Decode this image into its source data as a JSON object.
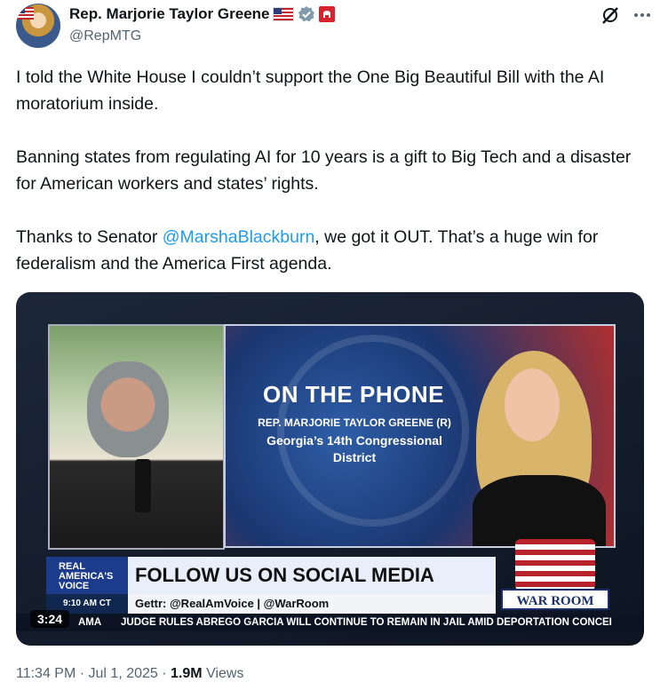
{
  "author": {
    "name": "Rep. Marjorie Taylor Greene",
    "handle": "@RepMTG"
  },
  "icons": {
    "flag": "us-flag-icon",
    "verified": "verified-badge-icon",
    "affiliate": "gop-badge-icon",
    "grok": "grok-icon",
    "more": "more-icon"
  },
  "tweet": {
    "p1": "I told the White House I couldn’t support the One Big Beautiful Bill with the AI moratorium inside.",
    "p2": "Banning states from regulating AI for 10 years is a gift to Big Tech and a disaster for American workers and states’ rights.",
    "p3_before": "Thanks to Senator ",
    "p3_mention": "@MarshaBlackburn",
    "p3_after": ", we got it OUT. That’s a huge win for federalism and the America First agenda."
  },
  "video": {
    "phone_title": "ON THE PHONE",
    "phone_name": "REP. MARJORIE TAYLOR GREENE (R)",
    "phone_district_1": "Georgia’s 14th Congressional",
    "phone_district_2": "District",
    "network_1": "REAL",
    "network_2": "AMERICA'S",
    "network_3": "VOICE",
    "time": "9:10 AM CT",
    "banner": "FOLLOW US ON SOCIAL MEDIA",
    "gettr": "Gettr: @RealAmVoice | @WarRoom",
    "show_logo": "WAR ROOM",
    "crawl_prefix": "AMA",
    "crawl_text": "JUDGE RULES ABREGO GARCIA WILL CONTINUE TO REMAIN IN JAIL AMID DEPORTATION CONCEI",
    "duration": "3:24"
  },
  "meta": {
    "time": "11:34 PM",
    "date": "Jul 1, 2025",
    "views_count": "1.9M",
    "views_label": "Views"
  },
  "colors": {
    "accent": "#1d9bf0",
    "verified": "#829aab",
    "affiliate": "#d8222c"
  }
}
